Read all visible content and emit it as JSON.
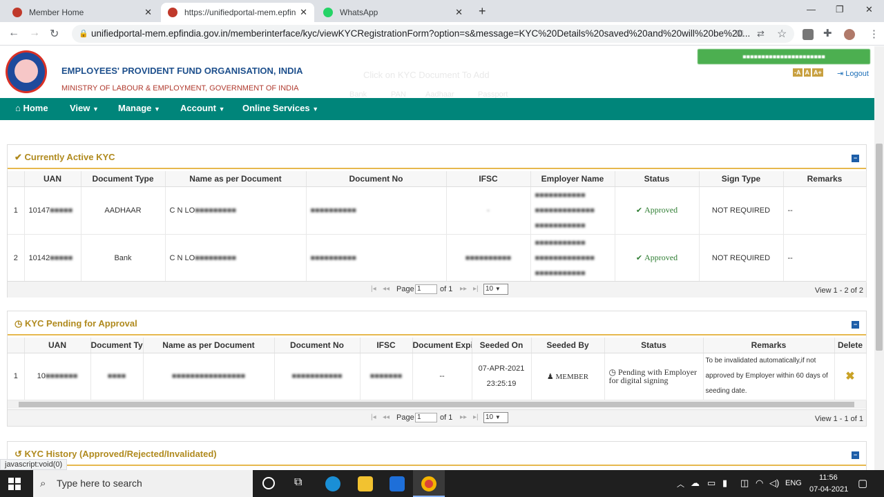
{
  "browser": {
    "tabs": [
      {
        "label": "Member Home",
        "icon": "epfo-favicon"
      },
      {
        "label": "https://unifiedportal-mem.epfindi",
        "icon": "epfo-favicon"
      },
      {
        "label": "WhatsApp",
        "icon": "whatsapp-icon"
      }
    ],
    "url": "unifiedportal-mem.epfindia.gov.in/memberinterface/kyc/viewKYCRegistrationForm?option=s&message=KYC%20Details%20saved%20and%20will%20be%20..."
  },
  "header": {
    "org_name": "EMPLOYEES' PROVIDENT FUND ORGANISATION, INDIA",
    "ministry": "MINISTRY OF LABOUR & EMPLOYMENT, GOVERNMENT OF INDIA",
    "font_small": "-A",
    "font_normal": "A",
    "font_large": "A+",
    "logout": "Logout",
    "ghost_title": "Click on KYC Document To Add",
    "ghost_tabs": [
      "Bank",
      "PAN",
      "Aadhaar",
      "Passport"
    ]
  },
  "nav": {
    "home": "Home",
    "view": "View",
    "manage": "Manage",
    "account": "Account",
    "online_services": "Online Services"
  },
  "active_kyc": {
    "title": "Currently Active KYC",
    "columns": [
      "UAN",
      "Document Type",
      "Name as per Document",
      "Document No",
      "IFSC",
      "Employer Name",
      "Status",
      "Sign Type",
      "Remarks"
    ],
    "rows": [
      {
        "num": "1",
        "uan": "10147",
        "doc_type": "AADHAAR",
        "name": "C N LO",
        "status": "Approved",
        "sign_type": "NOT REQUIRED",
        "remarks": "--"
      },
      {
        "num": "2",
        "uan": "10142",
        "doc_type": "Bank",
        "name": "C N LO",
        "status": "Approved",
        "sign_type": "NOT REQUIRED",
        "remarks": "--"
      }
    ],
    "pager": {
      "page_label": "Page",
      "page_value": "1",
      "of_label": "of 1",
      "rows_per_page": "10",
      "view_text": "View 1 - 2 of 2"
    }
  },
  "pending_kyc": {
    "title": "KYC Pending for Approval",
    "columns": [
      "UAN",
      "Document Ty",
      "Name as per Document",
      "Document No",
      "IFSC",
      "Document Expi",
      "Seeded On",
      "Seeded By",
      "Status",
      "Remarks",
      "Delete"
    ],
    "rows": [
      {
        "num": "1",
        "uan": "10",
        "expiry": "--",
        "seeded_on_date": "07-APR-2021",
        "seeded_on_time": "23:25:19",
        "seeded_by": "MEMBER",
        "status": "Pending with Employer for digital signing",
        "remarks": "To be invalidated automatically,if not approved by Employer within 60 days of seeding date."
      }
    ],
    "pager": {
      "page_label": "Page",
      "page_value": "1",
      "of_label": "of 1",
      "rows_per_page": "10",
      "view_text": "View 1 - 1 of 1"
    }
  },
  "history_kyc": {
    "title": "KYC History (Approved/Rejected/Invalidated)"
  },
  "status_bar": "javascript:void(0)",
  "taskbar": {
    "search_placeholder": "Type here to search",
    "lang": "ENG",
    "time": "11:56",
    "date": "07-04-2021"
  },
  "colors": {
    "nav_bg": "#00857a",
    "panel_title": "#b08a1e",
    "approved": "#2e7d32",
    "org_blue": "#1d4f8c",
    "ministry_red": "#b03a2e"
  }
}
